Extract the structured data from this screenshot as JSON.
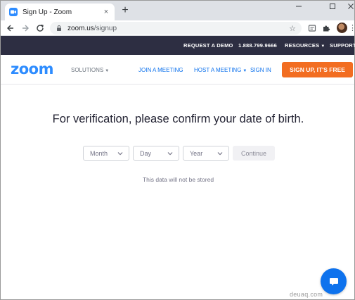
{
  "browser": {
    "tab_title": "Sign Up - Zoom",
    "tab_close": "×",
    "new_tab": "+",
    "url_domain": "zoom.us",
    "url_path": "/signup"
  },
  "topbar": {
    "request_demo": "REQUEST A DEMO",
    "phone": "1.888.799.9666",
    "resources": "RESOURCES",
    "support": "SUPPORT"
  },
  "nav": {
    "logo": "zoom",
    "solutions": "SOLUTIONS",
    "join_meeting": "JOIN A MEETING",
    "host_meeting": "HOST A MEETING",
    "sign_in": "SIGN IN",
    "signup_button": "SIGN UP, IT'S FREE"
  },
  "form": {
    "heading": "For verification, please confirm your date of birth.",
    "month": "Month",
    "day": "Day",
    "year": "Year",
    "continue": "Continue",
    "note": "This data will not be stored"
  },
  "watermark": "deuaq.com",
  "colors": {
    "brand_blue": "#2d8cff",
    "link_blue": "#0e72ed",
    "cta_orange": "#f26d21",
    "topbar_bg": "#2d2e42"
  },
  "icons": [
    "zoom-favicon-icon",
    "back-arrow-icon",
    "forward-arrow-icon",
    "reload-icon",
    "lock-icon",
    "star-icon",
    "extension-icon",
    "puzzle-icon",
    "chevron-down-icon",
    "chat-icon"
  ]
}
